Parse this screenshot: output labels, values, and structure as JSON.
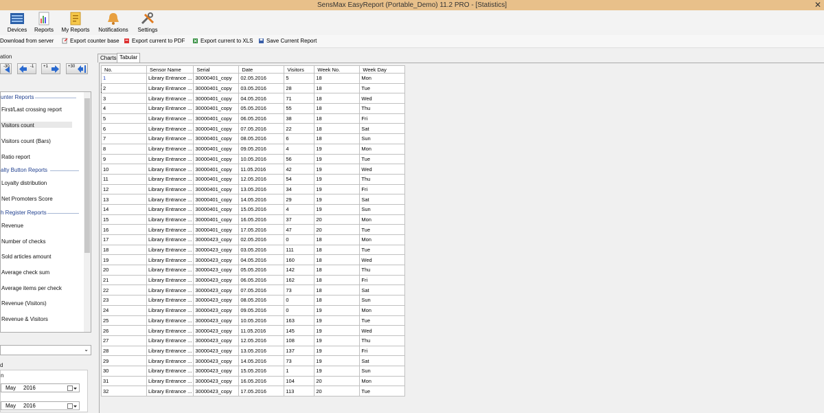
{
  "window": {
    "title": "SensMax EasyReport (Portable_Demo) 11.2 PRO - [Statistics]",
    "close_glyph": "✕"
  },
  "ribbon": [
    {
      "label": "Devices",
      "icon": "devices-icon"
    },
    {
      "label": "Reports",
      "icon": "reports-icon"
    },
    {
      "label": "My Reports",
      "icon": "my-reports-icon"
    },
    {
      "label": "Notifications",
      "icon": "notifications-icon"
    },
    {
      "label": "Settings",
      "icon": "settings-icon"
    }
  ],
  "toolbar": {
    "download": "Download from server",
    "export_base": "Export counter base",
    "export_pdf": "Export current to PDF",
    "export_xls": "Export current to XLS",
    "save_report": "Save Current Report"
  },
  "navigation": {
    "label": "ation",
    "buttons": [
      {
        "num": "-30",
        "icon": "fast-back-icon"
      },
      {
        "num": "-1",
        "icon": "back-arrow-icon"
      },
      {
        "num": "+1",
        "icon": "forward-arrow-icon"
      },
      {
        "num": "+30",
        "icon": "fast-forward-icon"
      }
    ]
  },
  "report_list": {
    "groups": [
      {
        "heading": "unter Reports",
        "items": [
          "First/Last crossing report",
          "Visitors count",
          "Visitors count (Bars)",
          "Ratio report"
        ]
      },
      {
        "heading": "alty Button Reports",
        "items": [
          "Loyalty distribution",
          "Net Promoters Score"
        ]
      },
      {
        "heading": "h Register Reports",
        "items": [
          "Revenue",
          "Number of checks",
          "Sold articles amount",
          "Average check sum",
          "Average items per check",
          "Revenue (Visitors)",
          "Revenue & Visitors"
        ]
      }
    ],
    "selected": "Visitors count"
  },
  "period": {
    "label": "d",
    "sub_label": "n",
    "from": {
      "month": "May",
      "year": "2016"
    },
    "to": {
      "month": "May",
      "year": "2016"
    }
  },
  "tabs": [
    {
      "label": "Charts",
      "active": false
    },
    {
      "label": "Tabular",
      "active": true
    }
  ],
  "table": {
    "headers": [
      "No.",
      "Sensor Name",
      "Serial",
      "Date",
      "Visitors",
      "Week No.",
      "Week Day"
    ],
    "rows": [
      [
        "1",
        "Library Entrance ...",
        "30000401_copy",
        "02.05.2016",
        "5",
        "18",
        "Mon"
      ],
      [
        "2",
        "Library Entrance ...",
        "30000401_copy",
        "03.05.2016",
        "28",
        "18",
        "Tue"
      ],
      [
        "3",
        "Library Entrance ...",
        "30000401_copy",
        "04.05.2016",
        "71",
        "18",
        "Wed"
      ],
      [
        "4",
        "Library Entrance ...",
        "30000401_copy",
        "05.05.2016",
        "55",
        "18",
        "Thu"
      ],
      [
        "5",
        "Library Entrance ...",
        "30000401_copy",
        "06.05.2016",
        "38",
        "18",
        "Fri"
      ],
      [
        "6",
        "Library Entrance ...",
        "30000401_copy",
        "07.05.2016",
        "22",
        "18",
        "Sat"
      ],
      [
        "7",
        "Library Entrance ...",
        "30000401_copy",
        "08.05.2016",
        "6",
        "18",
        "Sun"
      ],
      [
        "8",
        "Library Entrance ...",
        "30000401_copy",
        "09.05.2016",
        "4",
        "19",
        "Mon"
      ],
      [
        "9",
        "Library Entrance ...",
        "30000401_copy",
        "10.05.2016",
        "56",
        "19",
        "Tue"
      ],
      [
        "10",
        "Library Entrance ...",
        "30000401_copy",
        "11.05.2016",
        "42",
        "19",
        "Wed"
      ],
      [
        "11",
        "Library Entrance ...",
        "30000401_copy",
        "12.05.2016",
        "54",
        "19",
        "Thu"
      ],
      [
        "12",
        "Library Entrance ...",
        "30000401_copy",
        "13.05.2016",
        "34",
        "19",
        "Fri"
      ],
      [
        "13",
        "Library Entrance ...",
        "30000401_copy",
        "14.05.2016",
        "29",
        "19",
        "Sat"
      ],
      [
        "14",
        "Library Entrance ...",
        "30000401_copy",
        "15.05.2016",
        "4",
        "19",
        "Sun"
      ],
      [
        "15",
        "Library Entrance ...",
        "30000401_copy",
        "16.05.2016",
        "37",
        "20",
        "Mon"
      ],
      [
        "16",
        "Library Entrance ...",
        "30000401_copy",
        "17.05.2016",
        "47",
        "20",
        "Tue"
      ],
      [
        "17",
        "Library Entrance ...",
        "30000423_copy",
        "02.05.2016",
        "0",
        "18",
        "Mon"
      ],
      [
        "18",
        "Library Entrance ...",
        "30000423_copy",
        "03.05.2016",
        "111",
        "18",
        "Tue"
      ],
      [
        "19",
        "Library Entrance ...",
        "30000423_copy",
        "04.05.2016",
        "160",
        "18",
        "Wed"
      ],
      [
        "20",
        "Library Entrance ...",
        "30000423_copy",
        "05.05.2016",
        "142",
        "18",
        "Thu"
      ],
      [
        "21",
        "Library Entrance ...",
        "30000423_copy",
        "06.05.2016",
        "162",
        "18",
        "Fri"
      ],
      [
        "22",
        "Library Entrance ...",
        "30000423_copy",
        "07.05.2016",
        "73",
        "18",
        "Sat"
      ],
      [
        "23",
        "Library Entrance ...",
        "30000423_copy",
        "08.05.2016",
        "0",
        "18",
        "Sun"
      ],
      [
        "24",
        "Library Entrance ...",
        "30000423_copy",
        "09.05.2016",
        "0",
        "19",
        "Mon"
      ],
      [
        "25",
        "Library Entrance ...",
        "30000423_copy",
        "10.05.2016",
        "163",
        "19",
        "Tue"
      ],
      [
        "26",
        "Library Entrance ...",
        "30000423_copy",
        "11.05.2016",
        "145",
        "19",
        "Wed"
      ],
      [
        "27",
        "Library Entrance ...",
        "30000423_copy",
        "12.05.2016",
        "108",
        "19",
        "Thu"
      ],
      [
        "28",
        "Library Entrance ...",
        "30000423_copy",
        "13.05.2016",
        "137",
        "19",
        "Fri"
      ],
      [
        "29",
        "Library Entrance ...",
        "30000423_copy",
        "14.05.2016",
        "73",
        "19",
        "Sat"
      ],
      [
        "30",
        "Library Entrance ...",
        "30000423_copy",
        "15.05.2016",
        "1",
        "19",
        "Sun"
      ],
      [
        "31",
        "Library Entrance ...",
        "30000423_copy",
        "16.05.2016",
        "104",
        "20",
        "Mon"
      ],
      [
        "32",
        "Library Entrance ...",
        "30000423_copy",
        "17.05.2016",
        "113",
        "20",
        "Tue"
      ]
    ]
  },
  "colors": {
    "titlebar": "#e8c08a",
    "section_heading": "#1f3f8f",
    "first_cell_text": "#1a3fbf"
  }
}
